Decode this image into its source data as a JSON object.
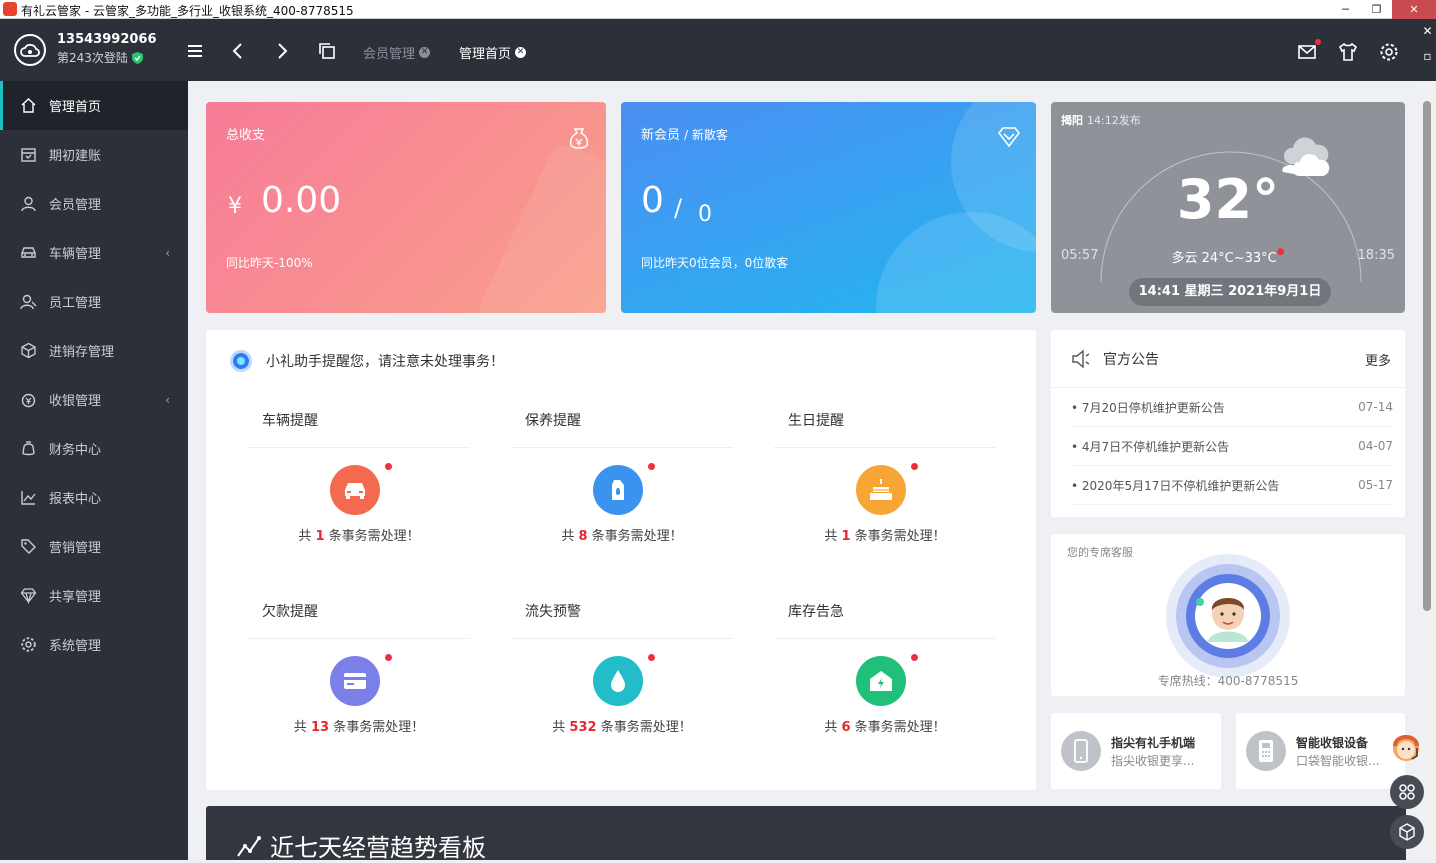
{
  "window": {
    "title": "有礼云管家 - 云管家_多功能_多行业_收银系统_400-8778515"
  },
  "header": {
    "phone": "13543992066",
    "logins": "第243次登陆",
    "tabs": [
      {
        "label": "会员管理",
        "active": false
      },
      {
        "label": "管理首页",
        "active": true
      }
    ]
  },
  "sidebar": {
    "items": [
      {
        "label": "管理首页",
        "icon": "home-icon",
        "active": true
      },
      {
        "label": "期初建账",
        "icon": "calendar-icon"
      },
      {
        "label": "会员管理",
        "icon": "user-icon"
      },
      {
        "label": "车辆管理",
        "icon": "car-icon",
        "caret": "‹"
      },
      {
        "label": "员工管理",
        "icon": "staff-icon"
      },
      {
        "label": "进销存管理",
        "icon": "box-icon"
      },
      {
        "label": "收银管理",
        "icon": "money-icon",
        "caret": "‹"
      },
      {
        "label": "财务中心",
        "icon": "finance-icon"
      },
      {
        "label": "报表中心",
        "icon": "report-icon"
      },
      {
        "label": "营销管理",
        "icon": "tag-icon"
      },
      {
        "label": "共享管理",
        "icon": "diamond-icon"
      },
      {
        "label": "系统管理",
        "icon": "settings-icon"
      }
    ]
  },
  "cards": {
    "revenue": {
      "title": "总收支",
      "currency": "¥",
      "value": "0.00",
      "compare": "同比昨天-100%"
    },
    "member": {
      "title": "新会员",
      "title2": "/ 新散客",
      "members": "0",
      "slash": "/",
      "guests": "0",
      "compare": "同比昨天0位会员，0位散客"
    },
    "weather": {
      "city": "揭阳",
      "published": "14:12发布",
      "temp": "32°",
      "desc": "多云 24°C~33°C",
      "sunrise": "05:57",
      "sunset": "18:35",
      "datetime": "14:41 星期三 2021年9月1日"
    }
  },
  "reminders": {
    "heading": "小礼助手提醒您，请注意未处理事务！",
    "prefix": "共",
    "suffix": "条事务需处理！",
    "items": [
      {
        "title": "车辆提醒",
        "count": "1",
        "color": "#f46a4e",
        "icon": "car-icon"
      },
      {
        "title": "保养提醒",
        "count": "8",
        "color": "#3a93ee",
        "icon": "oil-icon"
      },
      {
        "title": "生日提醒",
        "count": "1",
        "color": "#f7a534",
        "icon": "cake-icon"
      },
      {
        "title": "欠款提醒",
        "count": "13",
        "color": "#7b7fe8",
        "icon": "card-icon"
      },
      {
        "title": "流失预警",
        "count": "532",
        "color": "#22bdc9",
        "icon": "drop-icon"
      },
      {
        "title": "库存告急",
        "count": "6",
        "color": "#20c07a",
        "icon": "warehouse-icon"
      }
    ]
  },
  "notice": {
    "title": "官方公告",
    "more": "更多",
    "items": [
      {
        "text": "7月20日停机维护更新公告",
        "date": "07-14"
      },
      {
        "text": "4月7日不停机维护更新公告",
        "date": "04-07"
      },
      {
        "text": "2020年5月17日不停机维护更新公告",
        "date": "05-17"
      }
    ]
  },
  "service": {
    "label": "您的专席客服",
    "hotline": "专席热线：400-8778515"
  },
  "promos": [
    {
      "title": "指尖有礼手机端",
      "sub": "指尖收银更享..."
    },
    {
      "title": "智能收银设备",
      "sub": "口袋智能收银..."
    }
  ],
  "trend": {
    "title": "近七天经营趋势看板"
  }
}
